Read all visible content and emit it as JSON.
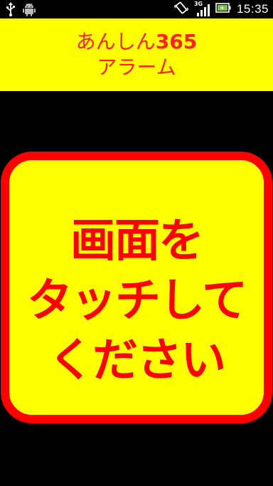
{
  "status_bar": {
    "time": "15:35",
    "network": "3G",
    "icons": [
      "usb-icon",
      "android-icon",
      "vibrate-icon",
      "signal-icon",
      "battery-icon"
    ]
  },
  "title": {
    "line1_prefix": "あんしん",
    "line1_number": "365",
    "line2": "アラーム"
  },
  "touch_button": {
    "line1": "画面を",
    "line2": "タッチして",
    "line3": "ください"
  },
  "colors": {
    "background": "#000000",
    "title_bg": "#ffff00",
    "title_text": "#ff2020",
    "button_bg": "#ffff00",
    "button_border": "#ff0000",
    "button_text": "#ff0000"
  }
}
